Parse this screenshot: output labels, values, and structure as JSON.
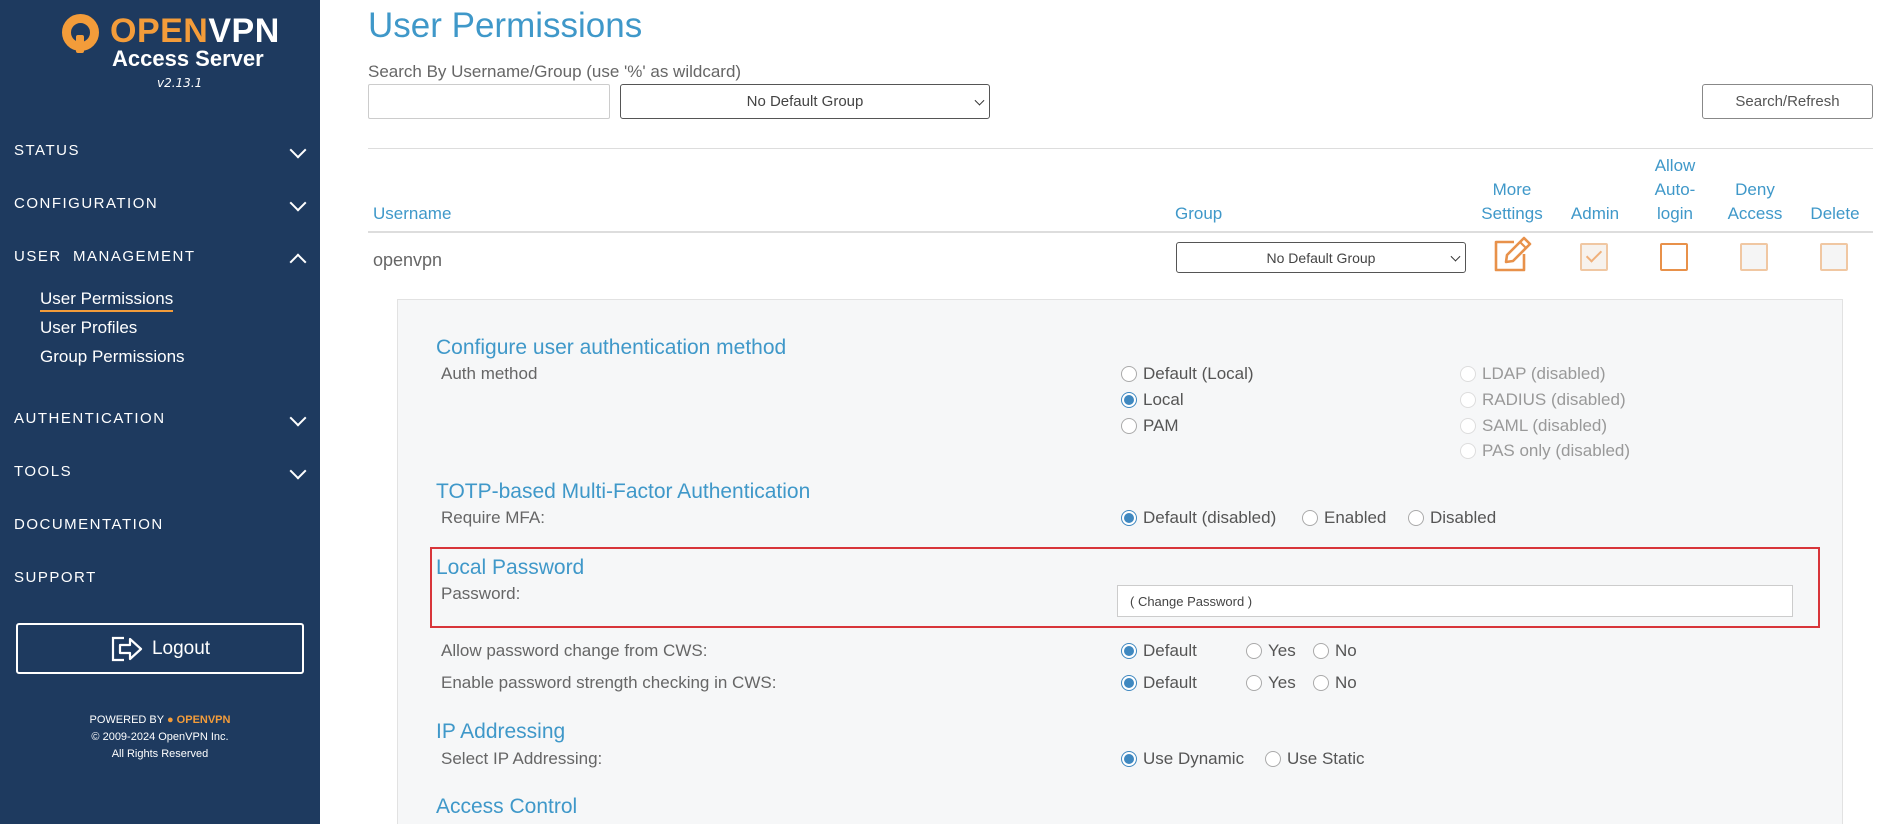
{
  "brand": {
    "name_open": "OPEN",
    "name_vpn": "VPN",
    "product": "Access Server",
    "version": "v2.13.1"
  },
  "nav": {
    "status": "STATUS",
    "configuration": "CONFIGURATION",
    "user_management": "USER  MANAGEMENT",
    "sub": {
      "user_permissions": "User Permissions",
      "user_profiles": "User Profiles",
      "group_permissions": "Group Permissions"
    },
    "authentication": "AUTHENTICATION",
    "tools": "TOOLS",
    "documentation": "DOCUMENTATION",
    "support": "SUPPORT",
    "logout": "Logout"
  },
  "footer": {
    "powered_by": "POWERED BY",
    "brand": "OPENVPN",
    "copyright": "© 2009-2024 OpenVPN Inc.",
    "rights": "All Rights Reserved"
  },
  "page": {
    "title": "User Permissions",
    "search_label": "Search By Username/Group (use '%' as wildcard)",
    "search_value": "",
    "group_filter": "No Default Group",
    "search_button": "Search/Refresh"
  },
  "table": {
    "headers": {
      "username": "Username",
      "group": "Group",
      "more_settings_1": "More",
      "more_settings_2": "Settings",
      "admin": "Admin",
      "allow_1": "Allow",
      "allow_2": "Auto-",
      "allow_3": "login",
      "deny_1": "Deny",
      "deny_2": "Access",
      "delete": "Delete"
    },
    "row": {
      "username": "openvpn",
      "group": "No Default Group",
      "admin": true,
      "allow_autologin": false,
      "deny_access": false,
      "delete": false
    }
  },
  "settings": {
    "auth": {
      "title": "Configure user authentication method",
      "label": "Auth method",
      "options": [
        "Default (Local)",
        "Local",
        "PAM"
      ],
      "disabled_options": [
        "LDAP (disabled)",
        "RADIUS (disabled)",
        "SAML (disabled)",
        "PAS only (disabled)"
      ],
      "selected": "Local"
    },
    "mfa": {
      "title": "TOTP-based Multi-Factor Authentication",
      "label": "Require MFA:",
      "options": [
        "Default (disabled)",
        "Enabled",
        "Disabled"
      ],
      "selected": "Default (disabled)"
    },
    "password": {
      "title": "Local Password",
      "label": "Password:",
      "placeholder": "( Change Password )"
    },
    "cws_change": {
      "label": "Allow password change from CWS:",
      "options": [
        "Default",
        "Yes",
        "No"
      ],
      "selected": "Default"
    },
    "cws_strength": {
      "label": "Enable password strength checking in CWS:",
      "options": [
        "Default",
        "Yes",
        "No"
      ],
      "selected": "Default"
    },
    "ip": {
      "title": "IP Addressing",
      "label": "Select IP Addressing:",
      "options": [
        "Use Dynamic",
        "Use Static"
      ],
      "selected": "Use Dynamic"
    },
    "access": {
      "title": "Access Control"
    }
  }
}
